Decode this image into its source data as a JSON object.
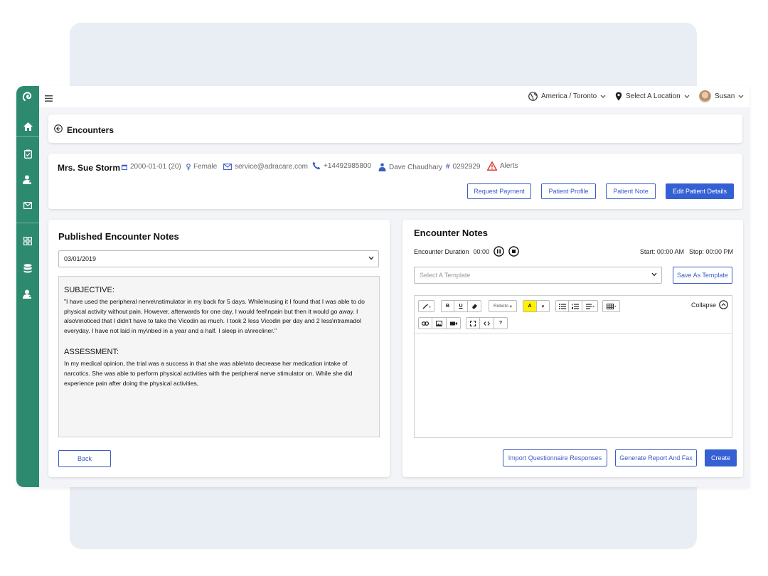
{
  "topbar": {
    "timezone": "America / Toronto",
    "location": "Select A Location",
    "user": "Susan"
  },
  "encounters": {
    "title": "Encounters"
  },
  "patient": {
    "name": "Mrs. Sue Storm",
    "dob": "2000-01-01 (20)",
    "gender": "Female",
    "email": "service@adracare.com",
    "phone": "+14492985800",
    "provider": "Dave Chaudhary",
    "id": "0292929",
    "alerts": "Alerts"
  },
  "actions": {
    "request_payment": "Request Payment",
    "patient_profile": "Patient Profile",
    "patient_note": "Patient Note",
    "edit_details": "Edit Patient Details"
  },
  "published": {
    "title": "Published Encounter Notes",
    "date": "03/01/2019",
    "sections": [
      {
        "heading": "SUBJECTIVE:",
        "body": "\"I have used the peripheral nerve\\nstimulator in my back for 5 days.  While\\nusing it I found that I  was able to do physical  activity without pain.  However, afterwards for one day, I would feel\\npain  but then it would go away.  I also\\nnoticed that I didn't have to take the Vicodin as much.   I took 2 less Vicodin per day and 2 less\\ntramadol everyday.  I have not laid in my\\nbed in a year  and a half.  I sleep in a\\nrecliner.\""
      },
      {
        "heading": "ASSESSMENT:",
        "body": "In my medical opinion, the trial was a success in that she was able\\nto decrease her medication  intake of narcotics. She was able to perform physical activities with the peripheral nerve  stimulator on.  While she did experience pain after doing the physical activities,"
      }
    ],
    "back": "Back"
  },
  "encounter_notes": {
    "title": "Encounter Notes",
    "duration_label": "Encounter Duration",
    "duration_value": "00:00",
    "start": "Start: 00:00 AM",
    "stop": "Stop: 00:00 PM",
    "template_placeholder": "Select A Template",
    "save_template": "Save As Template",
    "collapse": "Collapse",
    "font_name": "Roboto",
    "toolbar_bold": "B",
    "toolbar_underline": "U",
    "toolbar_highlight": "A",
    "toolbar_help": "?",
    "import": "Import Questionnaire Responses",
    "generate": "Generate Report And Fax",
    "create": "Create"
  },
  "colors": {
    "sidebar": "#2d8a6e",
    "primary": "#3560d4",
    "alert": "#d93025",
    "highlight": "#fff200"
  }
}
